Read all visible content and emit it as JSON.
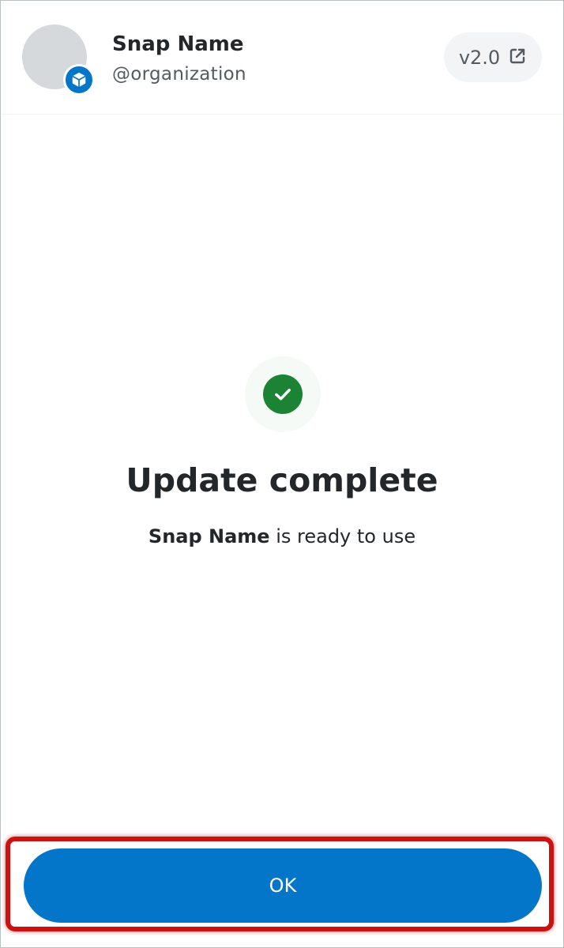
{
  "header": {
    "snap_name": "Snap Name",
    "organization": "@organization",
    "version": "v2.0",
    "version_icon": "external-link-icon",
    "avatar_badge_icon": "snap-box-icon"
  },
  "content": {
    "status_icon": "check-circle-icon",
    "title": "Update complete",
    "message_name": "Snap Name",
    "message_rest": " is ready to use"
  },
  "footer": {
    "ok_label": "OK"
  },
  "colors": {
    "primary": "#0376c9",
    "success": "#1c8234",
    "highlight": "#cc1111"
  }
}
